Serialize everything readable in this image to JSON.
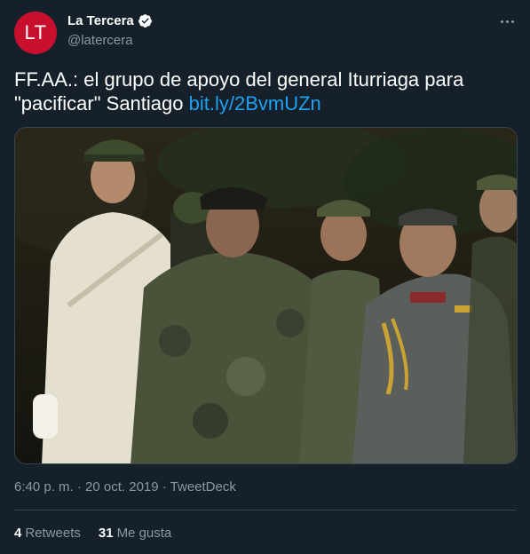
{
  "account": {
    "avatar_text": "LT",
    "display_name": "La Tercera",
    "handle": "@latercera",
    "verified": true
  },
  "tweet": {
    "text": "FF.AA.: el grupo de apoyo del general Iturriaga para \"pacificar\" Santiago ",
    "link": "bit.ly/2BvmUZn"
  },
  "media": {
    "description_icon": "photo"
  },
  "meta": {
    "timestamp": "6:40 p. m. · 20 oct. 2019 · TweetDeck"
  },
  "stats": {
    "retweets_count": "4",
    "retweets_label": "Retweets",
    "likes_count": "31",
    "likes_label": "Me gusta"
  },
  "colors": {
    "background": "#15202b",
    "accent": "#1da1f2",
    "avatar": "#c8102e",
    "muted": "#8899a6"
  }
}
